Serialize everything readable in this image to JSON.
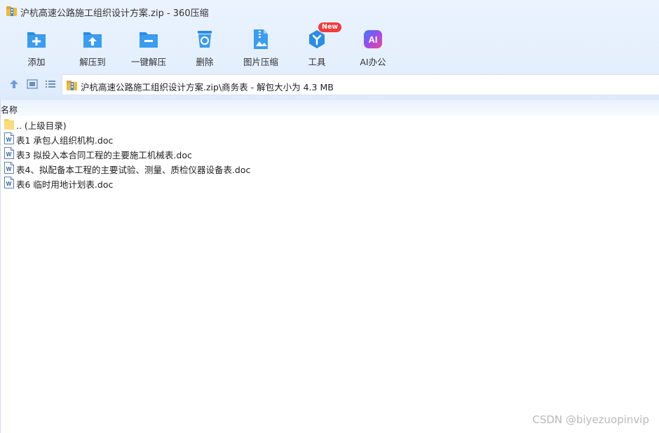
{
  "window": {
    "title": "沪杭高速公路施工组织设计方案.zip - 360压缩"
  },
  "toolbar": {
    "items": [
      {
        "label": "添加",
        "icon": "add-icon"
      },
      {
        "label": "解压到",
        "icon": "extract-to-icon"
      },
      {
        "label": "一键解压",
        "icon": "one-click-extract-icon"
      },
      {
        "label": "删除",
        "icon": "delete-icon"
      },
      {
        "label": "图片压缩",
        "icon": "image-compress-icon"
      },
      {
        "label": "工具",
        "icon": "tools-icon",
        "badge": "New"
      },
      {
        "label": "AI办公",
        "icon": "ai-office-icon"
      }
    ]
  },
  "address": {
    "path": "沪杭高速公路施工组织设计方案.zip\\商务表 - 解包大小为 4.3 MB"
  },
  "list": {
    "column_name": "名称",
    "rows": [
      {
        "name": ".. (上级目录)",
        "type": "folder"
      },
      {
        "name": "表1  承包人组织机构.doc",
        "type": "doc"
      },
      {
        "name": "表3 拟投入本合同工程的主要施工机械表.doc",
        "type": "doc"
      },
      {
        "name": "表4、拟配备本工程的主要试验、测量、质检仪器设备表.doc",
        "type": "doc"
      },
      {
        "name": "表6  临时用地计划表.doc",
        "type": "doc"
      }
    ]
  },
  "watermark": "CSDN @biyezuopinvip",
  "colors": {
    "accent_blue": "#2a8ce8",
    "badge_red": "#f23b3b",
    "folder_yellow": "#f7cf55"
  }
}
